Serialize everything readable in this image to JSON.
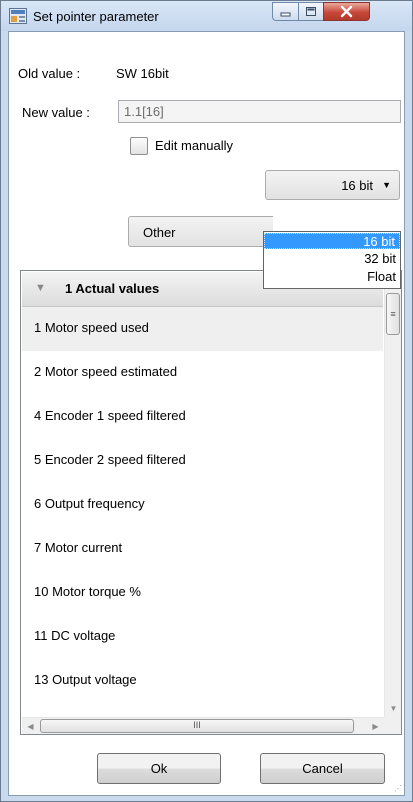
{
  "window": {
    "title": "Set pointer parameter",
    "icon": "app-settings-icon",
    "controls": [
      "minimize-icon",
      "maximize-icon",
      "close-icon"
    ]
  },
  "old_value": {
    "label": "Old value :",
    "value": "SW 16bit"
  },
  "new_value": {
    "label": "New value :",
    "value": "1.1[16]"
  },
  "edit_manually": {
    "label": "Edit manually",
    "checked": false
  },
  "bit_combo": {
    "selected": "16 bit",
    "options": [
      "16 bit",
      "32 bit",
      "Float"
    ],
    "open": true
  },
  "source_combo": {
    "selected": "Other"
  },
  "group": {
    "number": "1",
    "name": "Actual values",
    "expanded": true
  },
  "rows": [
    {
      "text": "1  Motor speed used",
      "highlighted": true
    },
    {
      "text": "2  Motor speed estimated",
      "highlighted": false
    },
    {
      "text": "4  Encoder 1 speed filtered",
      "highlighted": false
    },
    {
      "text": "5  Encoder 2 speed filtered",
      "highlighted": false
    },
    {
      "text": "6  Output frequency",
      "highlighted": false
    },
    {
      "text": "7  Motor current",
      "highlighted": false
    },
    {
      "text": "10  Motor torque %",
      "highlighted": false
    },
    {
      "text": "11  DC voltage",
      "highlighted": false
    },
    {
      "text": "13  Output voltage",
      "highlighted": false
    }
  ],
  "buttons": {
    "ok": "Ok",
    "cancel": "Cancel"
  },
  "scroll": {
    "grip_glyph": "III"
  },
  "colors": {
    "selection": "#3399ff",
    "close_button": "#c7483a",
    "frame": "#c9d9ee"
  }
}
